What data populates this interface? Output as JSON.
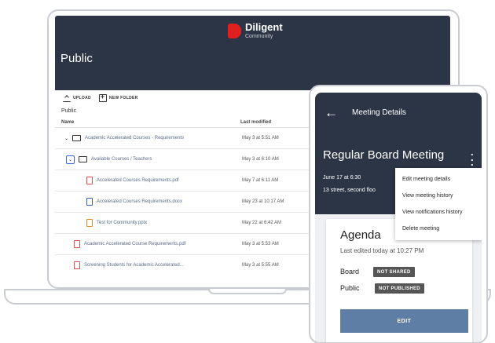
{
  "brand": {
    "name": "Diligent",
    "sub": "Community"
  },
  "laptop": {
    "page_title": "Public",
    "toolbar": {
      "upload": "UPLOAD",
      "new_folder": "NEW FOLDER"
    },
    "breadcrumb": "Public",
    "columns": {
      "name": "Name",
      "modified": "Last modified"
    },
    "rows": [
      {
        "name": "Academic Accelerated Courses - Requirements",
        "date": "May 3 at 5:51 AM",
        "kind": "folder"
      },
      {
        "name": "Available Courses / Teachers",
        "date": "May 3 at 6:10 AM",
        "kind": "folder"
      },
      {
        "name": "Accelerated Courses Requirements.pdf",
        "date": "May 7 at 6:11 AM",
        "kind": "pdf"
      },
      {
        "name": "Accelerated Courses Requirements.docx",
        "date": "May 23 at 10:17 AM",
        "kind": "doc"
      },
      {
        "name": "Test for Community.pptx",
        "date": "May 22 at 6:42 AM",
        "kind": "ppt"
      },
      {
        "name": "Academic Accelerated Course Requirements.pdf",
        "date": "May 3 at 5:53 AM",
        "kind": "pdf"
      },
      {
        "name": "Screening Students for Academic Accelerated...",
        "date": "May 3 at 5:55 AM",
        "kind": "pdf"
      }
    ]
  },
  "phone": {
    "header_title": "Meeting Details",
    "meeting_title": "Regular Board Meeting",
    "date": "June 17 at 6:30",
    "location": "13 street, second floo",
    "menu": [
      "Edit meeting details",
      "View meeting history",
      "View notifications history",
      "Delete meeting"
    ],
    "agenda": {
      "title": "Agenda",
      "last_edited": "Last edited today at 10:27 PM",
      "board_label": "Board",
      "board_status": "NOT SHARED",
      "public_label": "Public",
      "public_status": "NOT PUBLISHED",
      "edit_label": "EDIT"
    }
  }
}
